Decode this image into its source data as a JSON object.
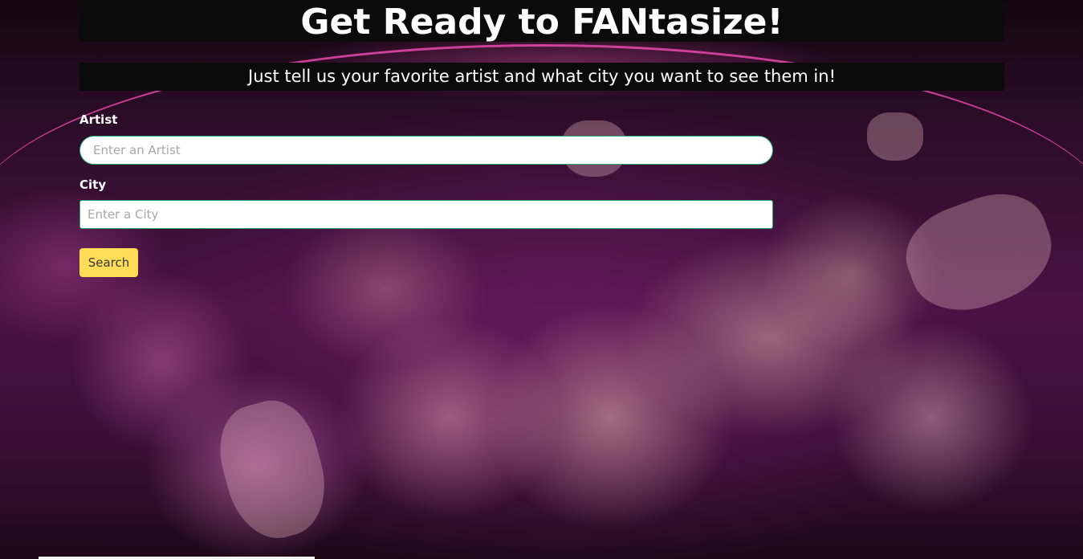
{
  "header": {
    "title": "Get Ready to FANtasize!",
    "subtitle": "Just tell us your favorite artist and what city you want to see them in!"
  },
  "form": {
    "artist_label": "Artist",
    "artist_placeholder": "Enter an Artist",
    "artist_value": "",
    "city_label": "City",
    "city_placeholder": "Enter a City",
    "city_value": "",
    "search_label": "Search"
  },
  "colors": {
    "header_bg": "#0b0b0b",
    "button_bg": "#ffdd57",
    "input_border": "#2aa876",
    "text": "#ffffff"
  },
  "background": {
    "icon": "concert-crowd-photo"
  }
}
